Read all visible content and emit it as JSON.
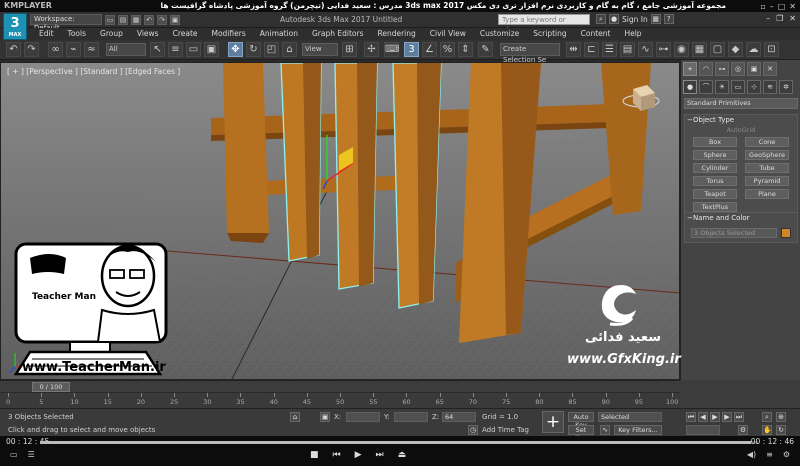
{
  "player": {
    "name": "KMPLAYER",
    "course_title": "مجموعه آموزشی جامع ، گام به گام و کاربردی نرم افزار تری دی مکس 3ds max 2017 مدرس : سعید فدایی (تیچرمن) گروه آموزشی پادشاه گرافیست ها",
    "time_elapsed": "00 : 12 : 45",
    "time_total": "00 : 12 : 46",
    "progress_fraction": 0.99
  },
  "title_bar": {
    "logo_text": "3",
    "logo_sub": "MAX",
    "workspace": "Workspace: Default",
    "app_title": "Autodesk 3ds Max 2017    Untitled",
    "search_placeholder": "Type a keyword or phrase",
    "sign_in": "Sign In"
  },
  "menu": [
    "Edit",
    "Tools",
    "Group",
    "Views",
    "Create",
    "Modifiers",
    "Animation",
    "Graph Editors",
    "Rendering",
    "Civil View",
    "Customize",
    "Scripting",
    "Content",
    "Help"
  ],
  "toolbar": {
    "filter": "All",
    "ref_coord": "View",
    "selection_set": "Create Selection Se"
  },
  "viewport": {
    "label": "[ + ] [Perspective ] [Standard ] [Edged Faces ]"
  },
  "command_panel": {
    "category": "Standard Primitives",
    "object_type_title": "Object Type",
    "autogrid": "AutoGrid",
    "primitives": [
      "Box",
      "Cone",
      "Sphere",
      "GeoSphere",
      "Cylinder",
      "Tube",
      "Torus",
      "Pyramid",
      "Teapot",
      "Plane",
      "TextPlus"
    ],
    "name_color_title": "Name and Color",
    "selection_name": "3 Objects Selected",
    "object_color": "#d68428"
  },
  "timeline": {
    "frame_label": "0 / 100",
    "ticks": [
      "0",
      "5",
      "10",
      "15",
      "20",
      "25",
      "30",
      "35",
      "40",
      "45",
      "50",
      "55",
      "60",
      "65",
      "70",
      "75",
      "80",
      "85",
      "90",
      "95",
      "100"
    ]
  },
  "status": {
    "selected": "3 Objects Selected",
    "prompt": "Click and drag to select and move objects",
    "x_label": "X:",
    "y_label": "Y:",
    "z_label": "Z:",
    "z_value": "64",
    "grid": "Grid = 1.0",
    "add_time_tag": "Add Time Tag",
    "auto_key": "Auto Key",
    "set_key": "Set Key",
    "key_mode": "Selected",
    "key_filters": "Key Filters..."
  },
  "watermark": {
    "teacher_name": "Teacher Man",
    "teacher_url": "www.TeacherMan.ir",
    "gfx_name": "سعید فدائی",
    "gfx_url": "www.GfxKing.ir"
  }
}
